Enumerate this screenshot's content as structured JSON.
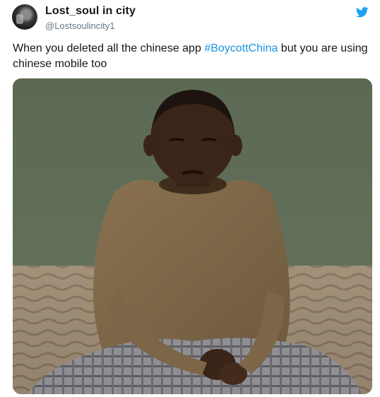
{
  "tweet": {
    "display_name": "Lost_soul in city",
    "handle": "@Lostsoulincity1",
    "text_before": "When you deleted all the chinese app ",
    "hashtag": "#BoycottChina",
    "text_after": " but you are using chinese mobile too",
    "icons": {
      "avatar": "avatar",
      "brand": "twitter-bird-icon"
    },
    "colors": {
      "hashtag": "#1b95e0",
      "brand": "#1da1f2",
      "handle": "#657786"
    }
  }
}
